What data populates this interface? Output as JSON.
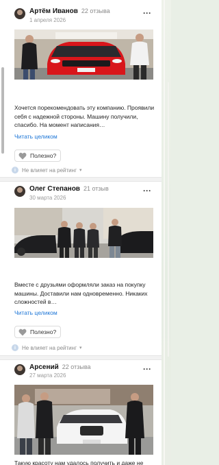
{
  "reviews": [
    {
      "author": "Артём Иванов",
      "count": "22 отзыва",
      "date": "1 апреля 2026",
      "text": "Хочется порекомендовать эту компанию. Проявили себя с надежной стороны. Машину получили, спасибо. На момент написания…",
      "read_more": "Читать целиком",
      "useful": "Полезно?",
      "no_rating": "Не влияет на рейтинг"
    },
    {
      "author": "Олег Степанов",
      "count": "21 отзыв",
      "date": "30 марта 2026",
      "text": "Вместе с друзьями оформляли заказ на покупку машины. Доставили нам одновременно. Никаких сложностей в…",
      "read_more": "Читать целиком",
      "useful": "Полезно?",
      "no_rating": "Не влияет на рейтинг"
    },
    {
      "author": "Арсений",
      "count": "22 отзыва",
      "date": "27 марта 2026",
      "text": "Такую красоту нам удалось получить и даже не"
    }
  ],
  "icons": {
    "more": "more-icon",
    "heart": "heart-icon",
    "info": "info-icon",
    "chevron": "chevron-down-icon"
  },
  "colors": {
    "link": "#1a74d6",
    "muted": "#8a8a8a",
    "car1": "#d8161b"
  }
}
